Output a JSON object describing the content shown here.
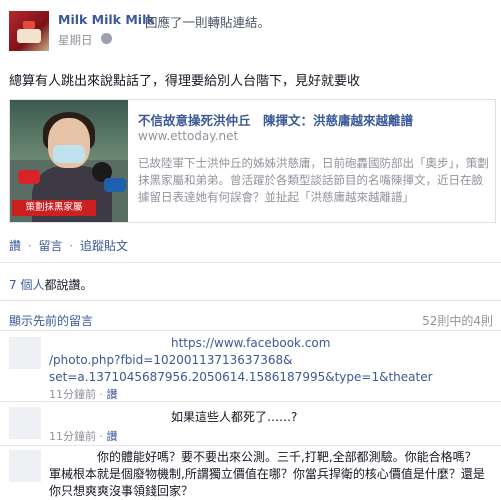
{
  "post": {
    "author": "Milk Milk Milk",
    "action": "回應了一則轉貼連結。",
    "time": "星期日",
    "text": "總算有人跳出來說點話了，得理要給別人台階下，見好就要收"
  },
  "link": {
    "title": "不信故意操死洪仲丘　陳揮文：洪慈庸越來越離譜",
    "domain": "www.ettoday.net",
    "description": "已故陸軍下士洪仲丘的姊姊洪慈庸，日前砲轟國防部出「奧步」，策劃抹黑家屬和弟弟。曾活躍於各類型談話節目的名嘴陳揮文，近日在臉據留日表達她有何誤會？並扯起「洪慈庸越來越離譜」",
    "thumb_caption": "策劃抹黑家屬"
  },
  "actions": {
    "like": "讚",
    "comment": "留言",
    "follow": "追蹤貼文",
    "sep": "·"
  },
  "likes": {
    "count": "7 個人",
    "suffix": "都說讚。"
  },
  "comments_header": {
    "prev": "顯示先前的留言",
    "count": "52則中的4則"
  },
  "comments": [
    {
      "text_lines": [
        "https://www.facebook.com",
        "/photo.php?fbid=10200113713637368&",
        "set=a.1371045687956.2050614.1586187995&type=1&theater"
      ],
      "time": "11分鐘前",
      "like": "讚"
    },
    {
      "text_lines": [
        "如果這些人都死了……?"
      ],
      "time": "11分鐘前",
      "like": "讚"
    },
    {
      "text_lines": [
        "你的體能好嗎？要不要出來公測。三千,打靶,全部都測驗。你能合格嗎？",
        "軍械根本就是個廢物機制,所謂獨立價值在哪？你當兵捍衛的核心價值是什麼？還是",
        "你只想爽爽沒事領錢回家？"
      ],
      "time": "",
      "like": ""
    }
  ],
  "colors": {
    "link": "#3b5998",
    "meta": "#90949c",
    "text": "#141823"
  }
}
